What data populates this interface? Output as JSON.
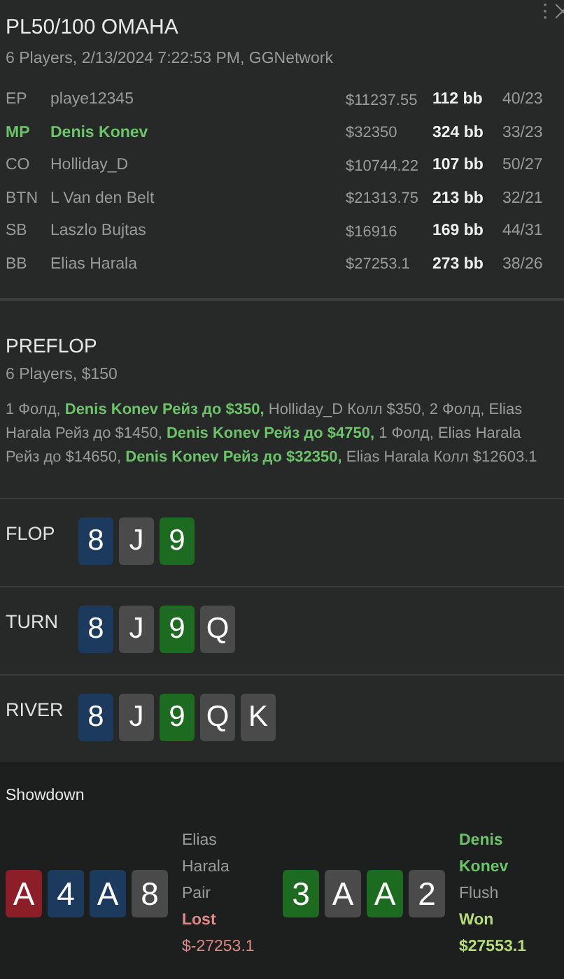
{
  "title": "PL50/100 OMAHA",
  "subtitle": "6 Players, 2/13/2024 7:22:53 PM, GGNetwork",
  "players": [
    {
      "position": "EP",
      "name": "playe12345",
      "stack": "$11237.55",
      "bb": "112 bb",
      "stats": "40/23",
      "hero": false
    },
    {
      "position": "MP",
      "name": "Denis Konev",
      "stack": "$32350",
      "bb": "324 bb",
      "stats": "33/23",
      "hero": true
    },
    {
      "position": "CO",
      "name": "Holliday_D",
      "stack": "$10744.22",
      "bb": "107 bb",
      "stats": "50/27",
      "hero": false
    },
    {
      "position": "BTN",
      "name": "L Van den Belt",
      "stack": "$21313.75",
      "bb": "213 bb",
      "stats": "32/21",
      "hero": false
    },
    {
      "position": "SB",
      "name": "Laszlo Bujtas",
      "stack": "$16916",
      "bb": "169 bb",
      "stats": "44/31",
      "hero": false
    },
    {
      "position": "BB",
      "name": "Elias Harala",
      "stack": "$27253.1",
      "bb": "273 bb",
      "stats": "38/26",
      "hero": false
    }
  ],
  "preflop": {
    "title": "PREFLOP",
    "info": "6 Players, $150",
    "actions": "1 Фолд, **Denis Konev Рейз до $350,** Holliday_D Колл $350, 2 Фолд, Elias Harala Рейз до $1450, **Denis Konev Рейз до $4750,** 1 Фолд, Elias Harala Рейз до $14650, **Denis Konev Рейз до $32350,** Elias Harala Колл $12603.1"
  },
  "streets": [
    {
      "title": "FLOP",
      "cards": [
        {
          "rank": "8",
          "color": "#1c3a5e"
        },
        {
          "rank": "J",
          "color": "#4a4a4a"
        },
        {
          "rank": "9",
          "color": "#1d6b20"
        }
      ]
    },
    {
      "title": "TURN",
      "cards": [
        {
          "rank": "8",
          "color": "#1c3a5e"
        },
        {
          "rank": "J",
          "color": "#4a4a4a"
        },
        {
          "rank": "9",
          "color": "#1d6b20"
        },
        {
          "rank": "Q",
          "color": "#4a4a4a"
        }
      ]
    },
    {
      "title": "RIVER",
      "cards": [
        {
          "rank": "8",
          "color": "#1c3a5e"
        },
        {
          "rank": "J",
          "color": "#4a4a4a"
        },
        {
          "rank": "9",
          "color": "#1d6b20"
        },
        {
          "rank": "Q",
          "color": "#4a4a4a"
        },
        {
          "rank": "K",
          "color": "#4a4a4a"
        }
      ]
    }
  ],
  "showdown": {
    "title": "Showdown",
    "hands": [
      {
        "cards": [
          {
            "rank": "A",
            "color": "#8b1e26"
          },
          {
            "rank": "4",
            "color": "#1c3a5e"
          },
          {
            "rank": "A",
            "color": "#1c3a5e"
          },
          {
            "rank": "8",
            "color": "#4a4a4a"
          }
        ],
        "name": "Elias Harala",
        "hero": false,
        "hand": "Pair",
        "won": false,
        "result": "Lost",
        "amount": "$-27253.1"
      },
      {
        "cards": [
          {
            "rank": "3",
            "color": "#1d6b20"
          },
          {
            "rank": "A",
            "color": "#4a4a4a"
          },
          {
            "rank": "A",
            "color": "#1d6b20"
          },
          {
            "rank": "2",
            "color": "#4a4a4a"
          }
        ],
        "name": "Denis Konev",
        "hero": true,
        "hand": "Flush",
        "won": true,
        "result": "Won",
        "amount": "$27553.1"
      }
    ]
  }
}
